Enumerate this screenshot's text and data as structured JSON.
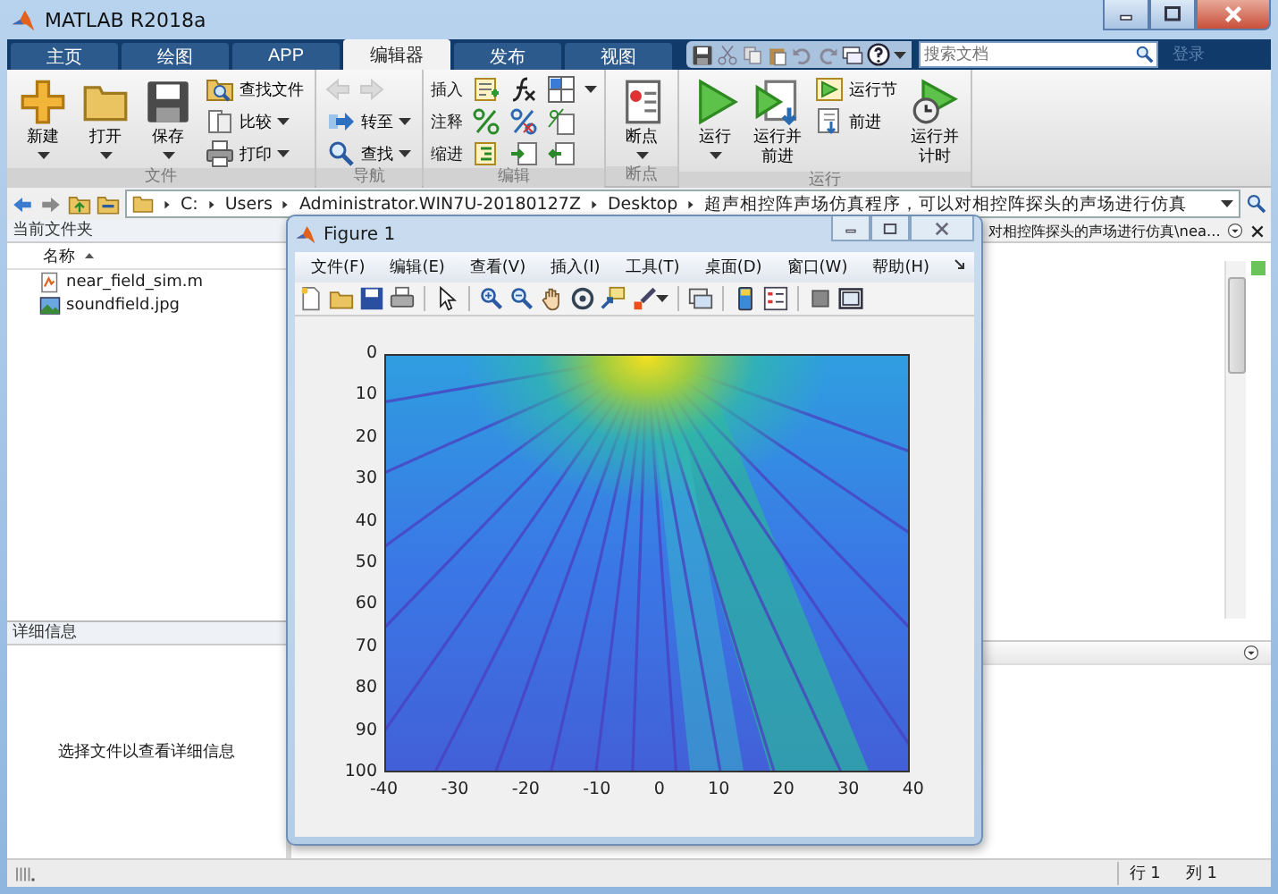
{
  "window": {
    "title": "MATLAB R2018a"
  },
  "tabs": [
    {
      "label": "主页",
      "selected": false
    },
    {
      "label": "绘图",
      "selected": false
    },
    {
      "label": "APP",
      "selected": false
    },
    {
      "label": "编辑器",
      "selected": true
    },
    {
      "label": "发布",
      "selected": false
    },
    {
      "label": "视图",
      "selected": false
    }
  ],
  "search": {
    "placeholder": "搜索文档"
  },
  "sign_in": {
    "label": "登录",
    "disabled": true
  },
  "toolstrip": [
    {
      "title": "文件",
      "columns": [
        [
          {
            "kind": "large",
            "label": "新建",
            "dropdown": true
          }
        ],
        [
          {
            "kind": "large",
            "label": "打开",
            "dropdown": true
          }
        ],
        [
          {
            "kind": "large",
            "label": "保存",
            "dropdown": true
          }
        ],
        [
          {
            "kind": "small",
            "label": "查找文件",
            "dropdown": false
          },
          {
            "kind": "small",
            "label": "比较",
            "dropdown": true
          },
          {
            "kind": "small",
            "label": "打印",
            "dropdown": true
          }
        ]
      ]
    },
    {
      "title": "导航",
      "columns": [
        [
          {
            "kind": "arrows",
            "disabled": true
          },
          {
            "kind": "small",
            "label": "转至",
            "dropdown": true
          },
          {
            "kind": "small",
            "label": "查找",
            "dropdown": true
          }
        ]
      ]
    },
    {
      "title": "编辑",
      "columns": [
        [
          {
            "kind": "icons",
            "label": "插入",
            "dropdown": true
          },
          {
            "kind": "icons",
            "label": "注释",
            "dropdown": false
          },
          {
            "kind": "icons",
            "label": "缩进",
            "dropdown": false
          }
        ]
      ]
    },
    {
      "title": "断点",
      "columns": [
        [
          {
            "kind": "large",
            "label": "断点",
            "dropdown": true
          }
        ]
      ]
    },
    {
      "title": "运行",
      "columns": [
        [
          {
            "kind": "large",
            "label": "运行",
            "dropdown": true
          }
        ],
        [
          {
            "kind": "large",
            "label": "运行并前进",
            "dropdown": false
          }
        ],
        [
          {
            "kind": "small",
            "label": "运行节",
            "dropdown": false
          },
          {
            "kind": "small",
            "label": "前进",
            "dropdown": false
          }
        ],
        [
          {
            "kind": "large",
            "label": "运行并计时",
            "dropdown": false
          }
        ]
      ]
    }
  ],
  "address_bar": {
    "segments": [
      "C:",
      "Users",
      "Administrator.WIN7U-20180127Z",
      "Desktop",
      "超声相控阵声场仿真程序，可以对相控阵探头的声场进行仿真"
    ]
  },
  "current_folder": {
    "title": "当前文件夹",
    "column": "名称",
    "files": [
      {
        "name": "near_field_sim.m",
        "kind": "script"
      },
      {
        "name": "soundfield.jpg",
        "kind": "image"
      }
    ]
  },
  "details": {
    "title": "详细信息",
    "message": "选择文件以查看详细信息"
  },
  "editor": {
    "tab_path": "对相控阵探头的声场进行仿真\\nea..."
  },
  "status_bar": {
    "row_label": "行",
    "row": "1",
    "col_label": "列",
    "col": "1"
  },
  "figure": {
    "title": "Figure 1",
    "menus": [
      "文件(F)",
      "编辑(E)",
      "查看(V)",
      "插入(I)",
      "工具(T)",
      "桌面(D)",
      "窗口(W)",
      "帮助(H)"
    ],
    "y_ticks": [
      "0",
      "10",
      "20",
      "30",
      "40",
      "50",
      "60",
      "70",
      "80",
      "90",
      "100"
    ],
    "x_ticks": [
      "-40",
      "-30",
      "-20",
      "-10",
      "0",
      "10",
      "20",
      "30",
      "40"
    ]
  }
}
